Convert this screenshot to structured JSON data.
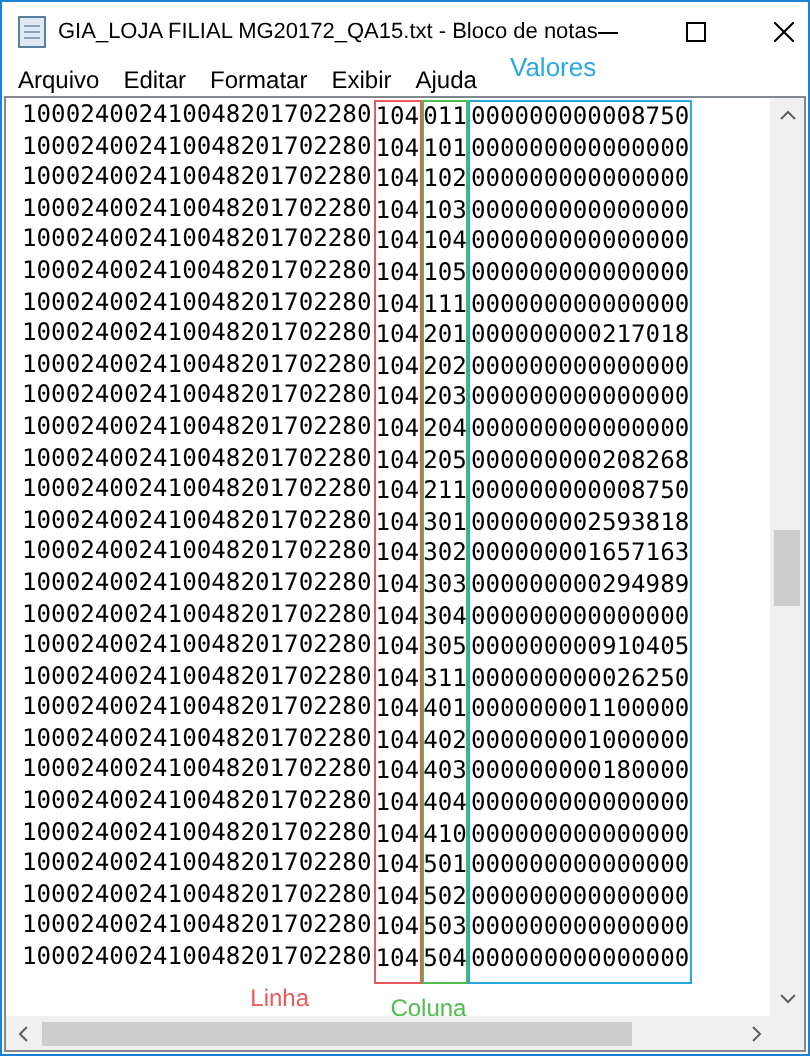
{
  "window": {
    "title": "GIA_LOJA FILIAL MG20172_QA15.txt - Bloco de notas"
  },
  "menu": [
    "Arquivo",
    "Editar",
    "Formatar",
    "Exibir",
    "Ajuda"
  ],
  "annotations": {
    "valores": "Valores",
    "linha": "Linha",
    "coluna": "Coluna"
  },
  "lines": [
    {
      "prefix": "100024002410048201702280",
      "linha": "104",
      "coluna": "011",
      "valor": "000000000008750"
    },
    {
      "prefix": "100024002410048201702280",
      "linha": "104",
      "coluna": "101",
      "valor": "000000000000000"
    },
    {
      "prefix": "100024002410048201702280",
      "linha": "104",
      "coluna": "102",
      "valor": "000000000000000"
    },
    {
      "prefix": "100024002410048201702280",
      "linha": "104",
      "coluna": "103",
      "valor": "000000000000000"
    },
    {
      "prefix": "100024002410048201702280",
      "linha": "104",
      "coluna": "104",
      "valor": "000000000000000"
    },
    {
      "prefix": "100024002410048201702280",
      "linha": "104",
      "coluna": "105",
      "valor": "000000000000000"
    },
    {
      "prefix": "100024002410048201702280",
      "linha": "104",
      "coluna": "111",
      "valor": "000000000000000"
    },
    {
      "prefix": "100024002410048201702280",
      "linha": "104",
      "coluna": "201",
      "valor": "000000000217018"
    },
    {
      "prefix": "100024002410048201702280",
      "linha": "104",
      "coluna": "202",
      "valor": "000000000000000"
    },
    {
      "prefix": "100024002410048201702280",
      "linha": "104",
      "coluna": "203",
      "valor": "000000000000000"
    },
    {
      "prefix": "100024002410048201702280",
      "linha": "104",
      "coluna": "204",
      "valor": "000000000000000"
    },
    {
      "prefix": "100024002410048201702280",
      "linha": "104",
      "coluna": "205",
      "valor": "000000000208268"
    },
    {
      "prefix": "100024002410048201702280",
      "linha": "104",
      "coluna": "211",
      "valor": "000000000008750"
    },
    {
      "prefix": "100024002410048201702280",
      "linha": "104",
      "coluna": "301",
      "valor": "000000002593818"
    },
    {
      "prefix": "100024002410048201702280",
      "linha": "104",
      "coluna": "302",
      "valor": "000000001657163"
    },
    {
      "prefix": "100024002410048201702280",
      "linha": "104",
      "coluna": "303",
      "valor": "000000000294989"
    },
    {
      "prefix": "100024002410048201702280",
      "linha": "104",
      "coluna": "304",
      "valor": "000000000000000"
    },
    {
      "prefix": "100024002410048201702280",
      "linha": "104",
      "coluna": "305",
      "valor": "000000000910405"
    },
    {
      "prefix": "100024002410048201702280",
      "linha": "104",
      "coluna": "311",
      "valor": "000000000026250"
    },
    {
      "prefix": "100024002410048201702280",
      "linha": "104",
      "coluna": "401",
      "valor": "000000001100000"
    },
    {
      "prefix": "100024002410048201702280",
      "linha": "104",
      "coluna": "402",
      "valor": "000000001000000"
    },
    {
      "prefix": "100024002410048201702280",
      "linha": "104",
      "coluna": "403",
      "valor": "000000000180000"
    },
    {
      "prefix": "100024002410048201702280",
      "linha": "104",
      "coluna": "404",
      "valor": "000000000000000"
    },
    {
      "prefix": "100024002410048201702280",
      "linha": "104",
      "coluna": "410",
      "valor": "000000000000000"
    },
    {
      "prefix": "100024002410048201702280",
      "linha": "104",
      "coluna": "501",
      "valor": "000000000000000"
    },
    {
      "prefix": "100024002410048201702280",
      "linha": "104",
      "coluna": "502",
      "valor": "000000000000000"
    },
    {
      "prefix": "100024002410048201702280",
      "linha": "104",
      "coluna": "503",
      "valor": "000000000000000"
    },
    {
      "prefix": "100024002410048201702280",
      "linha": "104",
      "coluna": "504",
      "valor": "000000000000000"
    }
  ]
}
